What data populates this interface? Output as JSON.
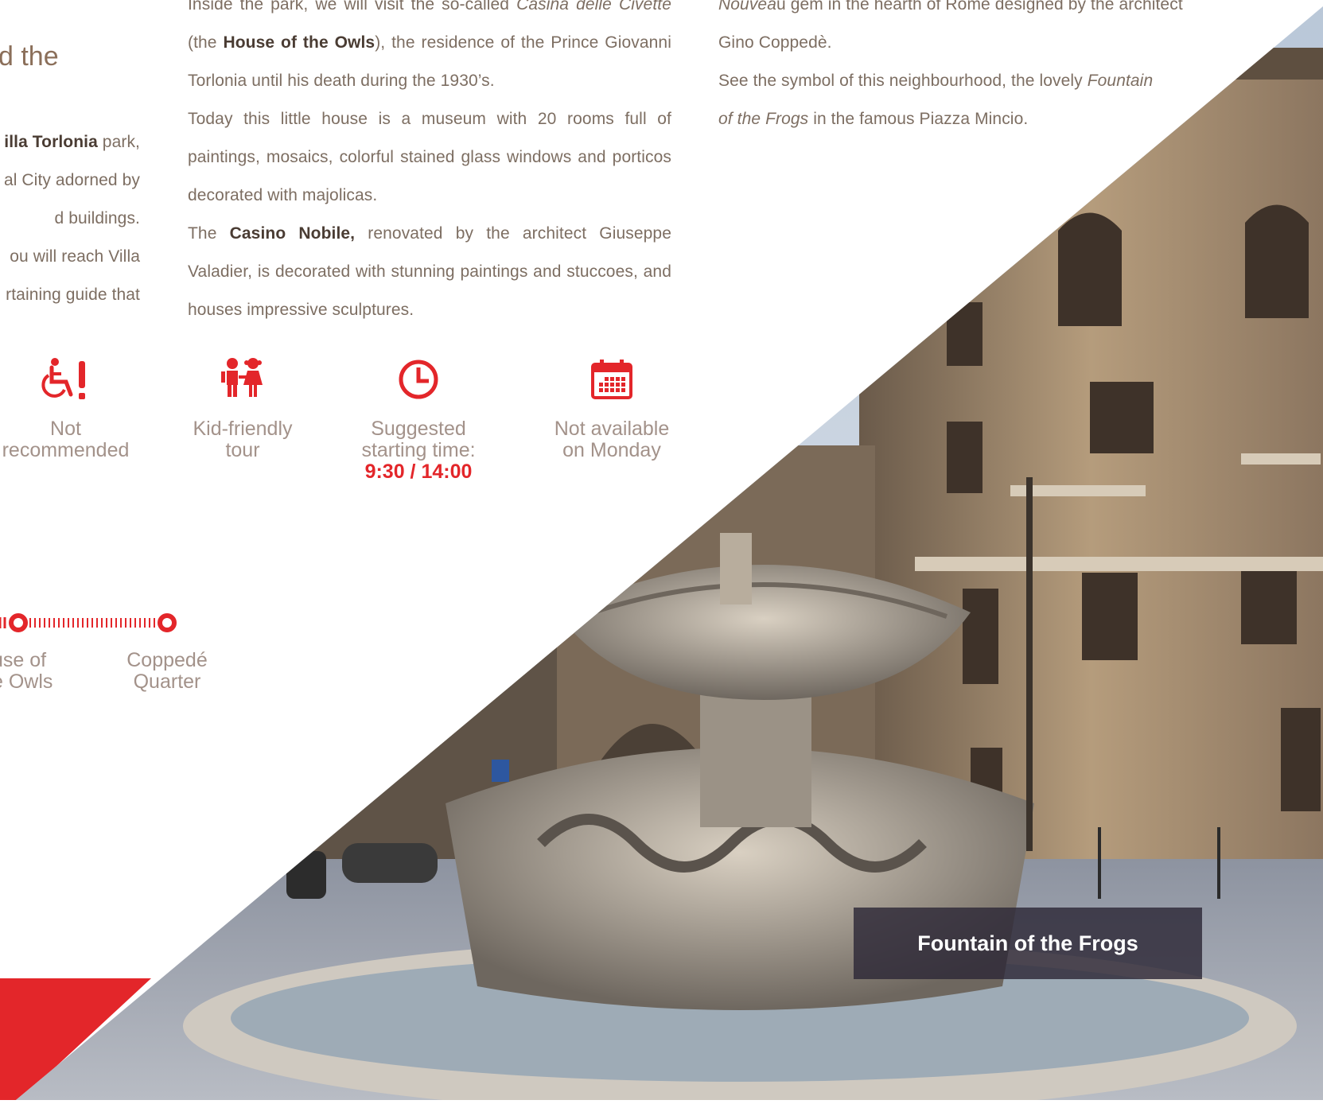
{
  "left_column": {
    "heading": "d the",
    "lines": [
      {
        "bold": "illa Torlonia",
        "rest": " park,"
      },
      {
        "text": "al City adorned by"
      },
      {
        "text": "d buildings."
      },
      {
        "text": "ou will reach Villa"
      },
      {
        "text": "rtaining guide that"
      }
    ]
  },
  "middle_column": {
    "p1_a": "Inside the park, we will visit the so-called ",
    "p1_italic": "Casina delle Civette",
    "p1_b": " (the ",
    "p1_bold": "House of the Owls",
    "p1_c": "), the residence of the Prince Giovanni Torlonia until his death during the 1930’s.",
    "p2": "Today this little house is a museum with 20 rooms full of paintings, mosaics, colorful stained glass windows and porticos decorated with majolicas.",
    "p3_a": "The ",
    "p3_bold": "Casino Nobile,",
    "p3_b": " renovated by the architect Giuseppe Valadier, is decorated with stunning paintings and stuccoes, and houses impressive sculptures."
  },
  "right_column": {
    "line1_italic": "Nouvea",
    "line1_rest": "u gem in the hearth of Rome designed by the architect",
    "line2": "Gino Coppedè.",
    "line3_a": "See the symbol of this neighbourhood, the lovely ",
    "line3_italic": "Fountain",
    "line4_italic": "of the Frogs",
    "line4_rest": " in the famous Piazza Mincio."
  },
  "features": [
    {
      "icon": "wheelchair-warning-icon",
      "line1": "Not",
      "line2": "recommended"
    },
    {
      "icon": "children-icon",
      "line1": "Kid-friendly",
      "line2": "tour"
    },
    {
      "icon": "clock-icon",
      "line1": "Suggested",
      "line2": "starting time:",
      "time": "9:30 / 14:00"
    },
    {
      "icon": "calendar-icon",
      "line1": "Not available",
      "line2": "on Monday"
    }
  ],
  "route": {
    "stops": [
      {
        "line1": "use of",
        "line2": "e Owls"
      },
      {
        "line1": "Coppedé",
        "line2": "Quarter"
      }
    ]
  },
  "photo": {
    "caption": "Fountain of the Frogs"
  },
  "colors": {
    "accent": "#e3262a",
    "text": "#7d6e62",
    "heading": "#8b6f5a",
    "caption_bg": "#2d2837"
  }
}
